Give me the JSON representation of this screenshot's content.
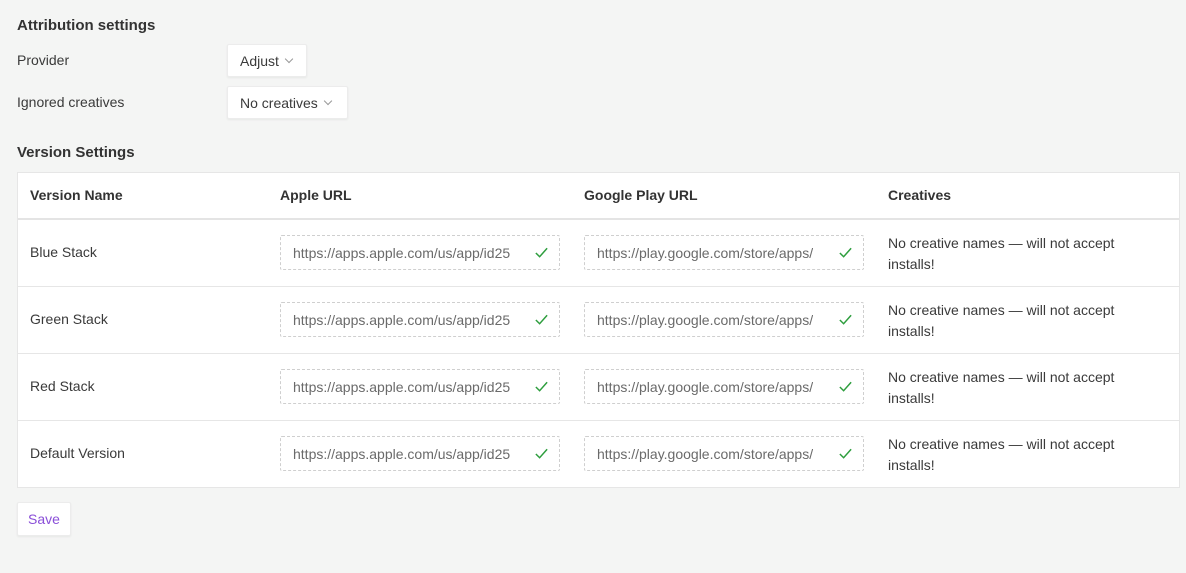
{
  "attribution": {
    "title": "Attribution settings",
    "provider_label": "Provider",
    "provider_value": "Adjust",
    "ignored_label": "Ignored creatives",
    "ignored_value": "No creatives"
  },
  "versions": {
    "title": "Version Settings",
    "columns": [
      "Version Name",
      "Apple URL",
      "Google Play URL",
      "Creatives"
    ],
    "rows": [
      {
        "name": "Blue Stack",
        "apple_url": "https://apps.apple.com/us/app/id25",
        "google_url": "https://play.google.com/store/apps/",
        "creatives": "No creative names — will not accept installs!"
      },
      {
        "name": "Green Stack",
        "apple_url": "https://apps.apple.com/us/app/id25",
        "google_url": "https://play.google.com/store/apps/",
        "creatives": "No creative names — will not accept installs!"
      },
      {
        "name": "Red Stack",
        "apple_url": "https://apps.apple.com/us/app/id25",
        "google_url": "https://play.google.com/store/apps/",
        "creatives": "No creative names — will not accept installs!"
      },
      {
        "name": "Default Version",
        "apple_url": "https://apps.apple.com/us/app/id25",
        "google_url": "https://play.google.com/store/apps/",
        "creatives": "No creative names — will not accept installs!"
      }
    ]
  },
  "save_label": "Save",
  "colors": {
    "check": "#2e9e3e",
    "save_text": "#8a4fd8"
  },
  "icons": {
    "dropdown": "chevron-down-icon",
    "valid": "check-icon"
  }
}
